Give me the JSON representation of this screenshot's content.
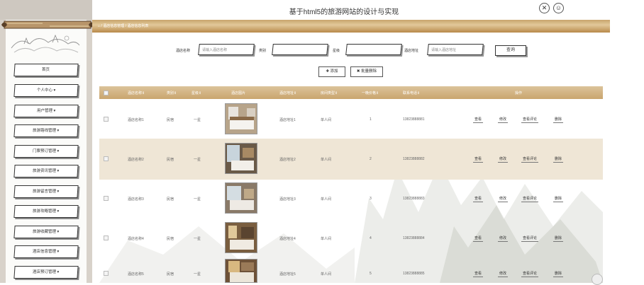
{
  "header": {
    "title": "基于html5的旅游网站的设计与实现",
    "close_icon": "close-icon",
    "user_icon": "user-icon"
  },
  "sidebar": {
    "items": [
      {
        "label": "首页"
      },
      {
        "label": "个人中心 ▾"
      },
      {
        "label": "用户管理 ▾"
      },
      {
        "label": "旅游路线管理 ▾"
      },
      {
        "label": "门票预订管理 ▾"
      },
      {
        "label": "旅游资讯管理 ▾"
      },
      {
        "label": "旅游留言管理 ▾"
      },
      {
        "label": "旅游攻略管理 ▾"
      },
      {
        "label": "旅游收藏管理 ▾"
      },
      {
        "label": "酒店信息管理 ▾"
      },
      {
        "label": "酒店预订管理 ▾"
      }
    ]
  },
  "breadcrumb": {
    "home_icon": "home-icon",
    "level1": "酒店信息管理",
    "sep": "/",
    "level2": "酒店信息列表"
  },
  "search": {
    "hotel_name_label": "酒店名称",
    "hotel_name_placeholder": "请输入酒店名称",
    "category_label": "类别",
    "category_value": "",
    "star_label": "星级",
    "star_value": "",
    "address_label": "酒店地址",
    "address_placeholder": "请输入酒店地址",
    "query_button": "查询"
  },
  "actions": {
    "add": "✚ 添加",
    "batch_delete": "✖ 批量删除"
  },
  "table": {
    "columns": [
      "酒店名称⇕",
      "类别⇕",
      "星级⇕",
      "酒店图片",
      "酒店地址⇕",
      "房间类型⇕",
      "一晚价格⇕",
      "联系电话⇕",
      "操作"
    ],
    "ops": [
      "查看",
      "修改",
      "查看评论",
      "删除"
    ],
    "rows": [
      {
        "name": "酒店名称1",
        "category": "民宿",
        "star": "一星",
        "address": "酒店地址1",
        "room": "单人间",
        "price": "1",
        "phone": "13823888881"
      },
      {
        "name": "酒店名称2",
        "category": "民宿",
        "star": "一星",
        "address": "酒店地址2",
        "room": "单人间",
        "price": "2",
        "phone": "13823888882"
      },
      {
        "name": "酒店名称3",
        "category": "民宿",
        "star": "一星",
        "address": "酒店地址3",
        "room": "单人间",
        "price": "3",
        "phone": "13823888883"
      },
      {
        "name": "酒店名称4",
        "category": "民宿",
        "star": "一星",
        "address": "酒店地址4",
        "room": "单人间",
        "price": "4",
        "phone": "13823888884"
      },
      {
        "name": "酒店名称5",
        "category": "民宿",
        "star": "一星",
        "address": "酒店地址5",
        "room": "单人间",
        "price": "5",
        "phone": "13823888885"
      }
    ]
  },
  "colors": {
    "accent_gold": "#caa56e",
    "row_highlight": "#efe6d6",
    "sidebar_bg": "#d8d2ca"
  }
}
